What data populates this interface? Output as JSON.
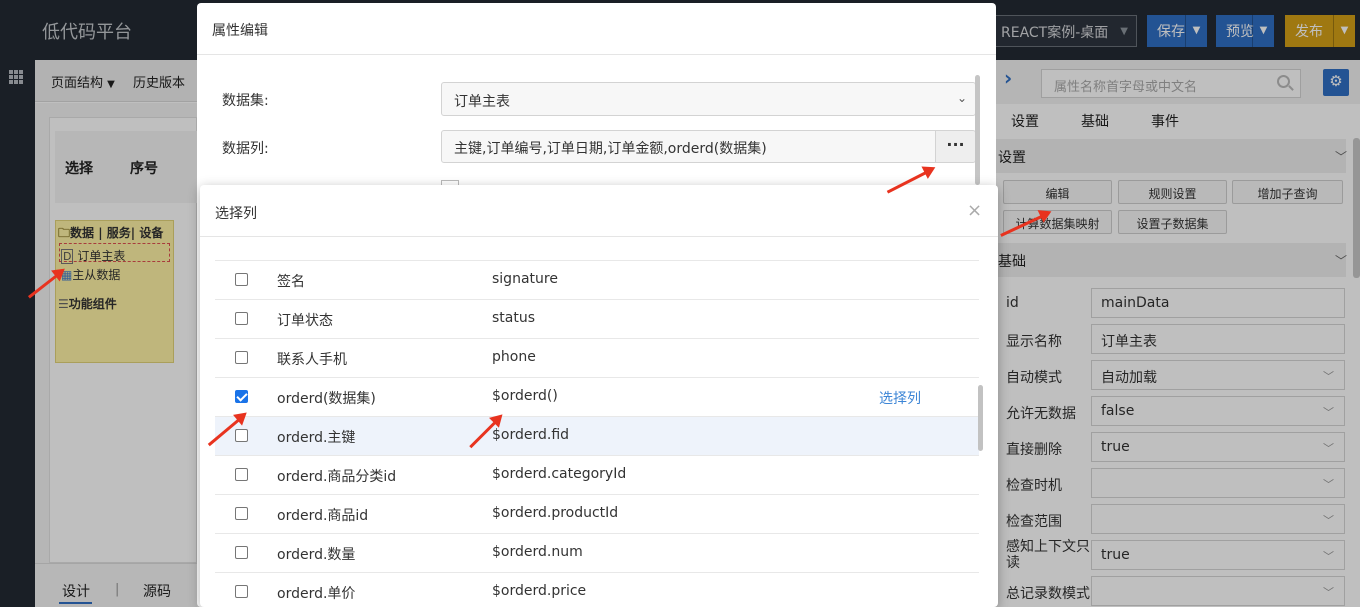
{
  "topbar": {
    "brand": "低代码平台",
    "version_select": "REACT案例-桌面",
    "save": "保存",
    "preview": "预览",
    "publish": "发布"
  },
  "left": {
    "page_structure": "页面结构",
    "history": "历史版本",
    "header_select": "选择",
    "header_no": "序号",
    "tree_root": "数据 | 服务| 设备",
    "tree_item_main": "订单主表",
    "tree_item_sub": "主从数据",
    "tree_item_func": "功能组件",
    "tab_design": "设计",
    "tab_source": "源码"
  },
  "right": {
    "search_placeholder": "属性名称首字母或中文名",
    "tabs": [
      "设置",
      "基础",
      "事件"
    ],
    "section_settings": "设置",
    "section_basic": "基础",
    "buttons": [
      "编辑",
      "规则设置",
      "增加子查询",
      "计算数据集映射",
      "设置子数据集"
    ],
    "fields": [
      {
        "label": "id",
        "value": "mainData"
      },
      {
        "label": "显示名称",
        "value": "订单主表"
      },
      {
        "label": "自动模式",
        "value": "自动加载"
      },
      {
        "label": "允许无数据",
        "value": "false"
      },
      {
        "label": "直接删除",
        "value": "true"
      },
      {
        "label": "检查时机",
        "value": ""
      },
      {
        "label": "检查范围",
        "value": ""
      },
      {
        "label": "感知上下文只读",
        "value": "true"
      },
      {
        "label": "总记录数模式",
        "value": ""
      }
    ]
  },
  "prop_modal": {
    "title": "属性编辑",
    "dataset_label": "数据集:",
    "dataset_value": "订单主表",
    "columns_label": "数据列:",
    "columns_value": "主键,订单编号,订单日期,订单金额,orderd(数据集)",
    "more": "···"
  },
  "column_modal": {
    "title": "选择列",
    "close": "×",
    "rows": [
      {
        "name": "签名",
        "field": "signature",
        "checked": false,
        "action": ""
      },
      {
        "name": "订单状态",
        "field": "status",
        "checked": false,
        "action": ""
      },
      {
        "name": "联系人手机",
        "field": "phone",
        "checked": false,
        "action": ""
      },
      {
        "name": "orderd(数据集)",
        "field": "$orderd()",
        "checked": true,
        "action": "选择列"
      },
      {
        "name": "orderd.主键",
        "field": "$orderd.fid",
        "checked": false,
        "action": ""
      },
      {
        "name": "orderd.商品分类id",
        "field": "$orderd.categoryId",
        "checked": false,
        "action": ""
      },
      {
        "name": "orderd.商品id",
        "field": "$orderd.productId",
        "checked": false,
        "action": ""
      },
      {
        "name": "orderd.数量",
        "field": "$orderd.num",
        "checked": false,
        "action": ""
      },
      {
        "name": "orderd.单价",
        "field": "$orderd.price",
        "checked": false,
        "action": ""
      }
    ]
  },
  "colors": {
    "accent": "#2f6fc4",
    "publish": "#d5a017",
    "annotation_arrow": "#e8331f",
    "topbar": "#232a33"
  }
}
